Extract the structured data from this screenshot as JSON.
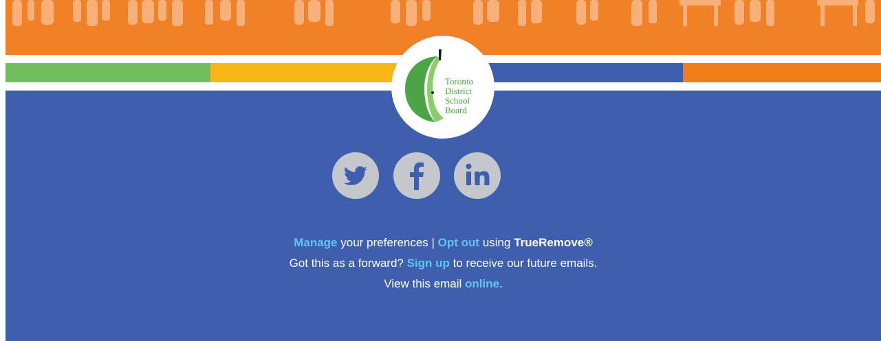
{
  "logo": {
    "name_lines": [
      "Toronto",
      "District",
      "School",
      "Board"
    ]
  },
  "social": [
    {
      "name": "twitter",
      "icon": "twitter-icon"
    },
    {
      "name": "facebook",
      "icon": "facebook-icon"
    },
    {
      "name": "linkedin",
      "icon": "linkedin-icon"
    }
  ],
  "footer": {
    "line1": {
      "manage_link": "Manage",
      "text1": " your preferences | ",
      "optout_link": "Opt out",
      "text2": " using ",
      "brand": "TrueRemove®"
    },
    "line2": {
      "text1": "Got this as a forward? ",
      "signup_link": "Sign up",
      "text2": " to receive our future emails."
    },
    "line3": {
      "text1": "View this email ",
      "online_link": "online",
      "text2": "."
    }
  },
  "colors": {
    "banner_orange": "#f08127",
    "body_blue": "#3d5fae",
    "stripe_green": "#72be5e",
    "stripe_yellow": "#f9b617",
    "stripe_blue": "#3d5fae",
    "stripe_orange": "#f07d15",
    "link_blue": "#61c3f0",
    "social_grey": "#c4c7cc"
  }
}
